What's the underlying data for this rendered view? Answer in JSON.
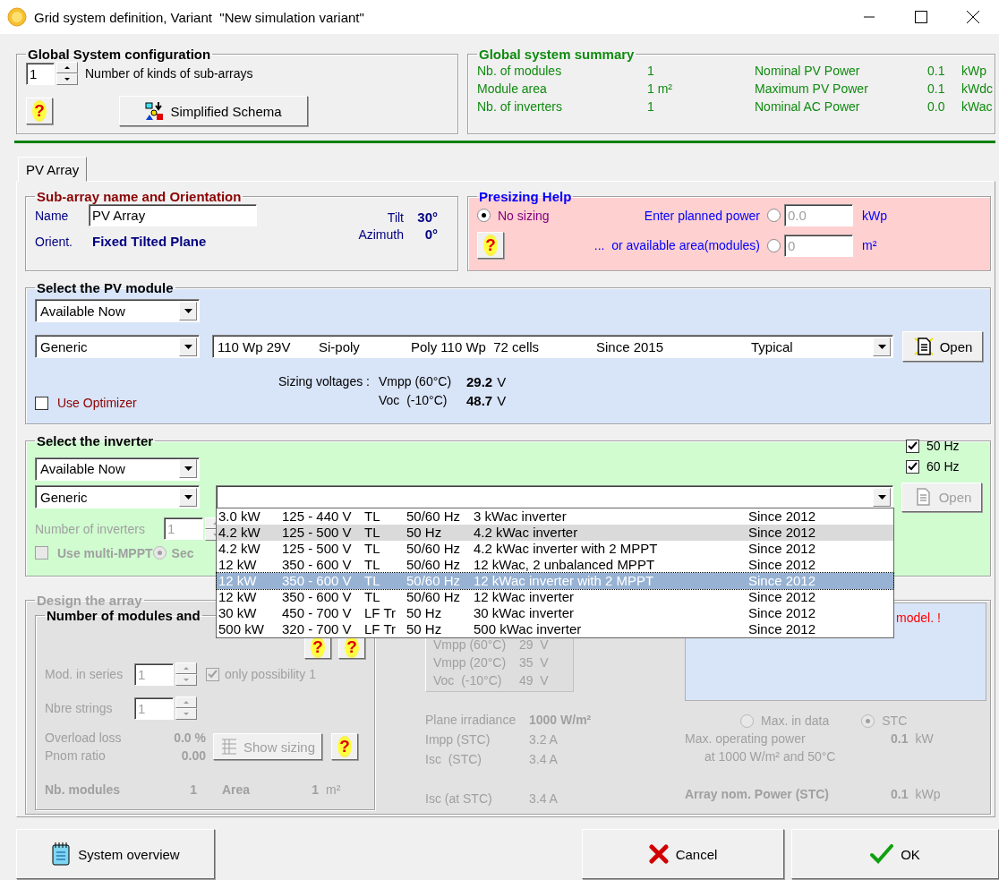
{
  "window": {
    "title": "Grid system definition, Variant  \"New simulation variant\""
  },
  "global_config": {
    "title": "Global System configuration",
    "sub_array_count": "1",
    "sub_array_label": "Number of kinds of sub-arrays",
    "help": "?",
    "schema_button": "Simplified Schema"
  },
  "summary": {
    "title": "Global system summary",
    "left": [
      {
        "label": "Nb. of modules",
        "value": "1"
      },
      {
        "label": "Module area",
        "value": "1 m²"
      },
      {
        "label": "Nb. of inverters",
        "value": "1"
      }
    ],
    "right": [
      {
        "label": "Nominal PV Power",
        "value": "0.1",
        "unit": "kWp"
      },
      {
        "label": "Maximum PV Power",
        "value": "0.1",
        "unit": "kWdc"
      },
      {
        "label": "Nominal AC Power",
        "value": "0.0",
        "unit": "kWac"
      }
    ]
  },
  "tabs": [
    {
      "label": "PV Array",
      "selected": true
    }
  ],
  "orientation": {
    "title": "Sub-array name and Orientation",
    "name_label": "Name",
    "name_value": "PV Array",
    "orient_label": "Orient.",
    "orient_value": "Fixed Tilted Plane",
    "tilt_label": "Tilt",
    "tilt_value": "30°",
    "azimuth_label": "Azimuth",
    "azimuth_value": "0°"
  },
  "presizing": {
    "title": "Presizing Help",
    "help": "?",
    "options": [
      {
        "label": "No sizing",
        "selected": true
      },
      {
        "label": "Enter planned power",
        "selected": false,
        "value": "0.0",
        "unit": "kWp"
      },
      {
        "label": "...  or available area(modules)",
        "selected": false,
        "value": "0",
        "unit": "m²"
      }
    ]
  },
  "pv_module": {
    "title": "Select the PV module",
    "availability": "Available Now",
    "manufacturer": "Generic",
    "module": [
      "110 Wp 29V",
      "Si-poly",
      "Poly 110 Wp  72 cells",
      "Since 2015",
      "Typical"
    ],
    "open_button": "Open",
    "use_optimizer": {
      "label": "Use Optimizer",
      "checked": false
    },
    "sizing_label": "Sizing voltages :",
    "voltages": [
      {
        "label": "Vmpp (60°C)",
        "value": "29.2",
        "unit": "V"
      },
      {
        "label": "Voc  (-10°C)",
        "value": "48.7",
        "unit": "V"
      }
    ]
  },
  "inverter": {
    "title": "Select the inverter",
    "availability": "Available Now",
    "manufacturer": "Generic",
    "frequencies": [
      {
        "label": "50 Hz",
        "checked": true
      },
      {
        "label": "60 Hz",
        "checked": true
      }
    ],
    "open_button": "Open",
    "open_disabled": true,
    "count": {
      "label": "Number of inverters",
      "value": "1",
      "disabled": true
    },
    "multi_mppt": {
      "label": "Use multi-MPPT",
      "checked": false,
      "disabled": true
    },
    "multi_mppt_option": {
      "label": "Sec",
      "selected": true
    },
    "dropdown": [
      {
        "cells": [
          "3.0 kW",
          "125 - 440 V",
          "TL",
          "50/60 Hz",
          "3 kWac inverter",
          "Since 2012"
        ],
        "selected": false,
        "hovered": false
      },
      {
        "cells": [
          "4.2 kW",
          "125 - 500 V",
          "TL",
          "50 Hz",
          "4.2 kWac inverter",
          "Since 2012"
        ],
        "selected": false,
        "hovered": true
      },
      {
        "cells": [
          "4.2 kW",
          "125 - 500 V",
          "TL",
          "50/60 Hz",
          "4.2 kWac inverter with 2 MPPT",
          "Since 2012"
        ],
        "selected": false,
        "hovered": false
      },
      {
        "cells": [
          "12 kW",
          "350 - 600 V",
          "TL",
          "50/60 Hz",
          "12 kWac, 2 unbalanced MPPT",
          "Since 2012"
        ],
        "selected": false,
        "hovered": false
      },
      {
        "cells": [
          "12 kW",
          "350 - 600 V",
          "TL",
          "50/60 Hz",
          "12 kWac inverter with 2 MPPT",
          "Since 2012"
        ],
        "selected": true,
        "hovered": false
      },
      {
        "cells": [
          "12 kW",
          "350 - 600 V",
          "TL",
          "50/60 Hz",
          "12 kWac inverter",
          "Since 2012"
        ],
        "selected": false,
        "hovered": false
      },
      {
        "cells": [
          "30 kW",
          "450 - 700 V",
          "LF Tr",
          "50 Hz",
          "30 kWac inverter",
          "Since 2012"
        ],
        "selected": false,
        "hovered": false
      },
      {
        "cells": [
          "500 kW",
          "320 - 700 V",
          "LF Tr",
          "50 Hz",
          "500 kWac inverter",
          "Since 2012"
        ],
        "selected": false,
        "hovered": false
      }
    ]
  },
  "design": {
    "title": "Design the array",
    "disabled": true,
    "modules_title": "Number of modules and",
    "helps": [
      "?",
      "?",
      "?"
    ],
    "series_label": "Mod. in series",
    "series_value": "1",
    "only_possibility": {
      "label": "only possibility 1",
      "checked": true
    },
    "strings_label": "Nbre strings",
    "strings_value": "1",
    "overload_label": "Overload loss",
    "overload_value": "0.0 %",
    "pnom_label": "Pnom ratio",
    "pnom_value": "0.00",
    "show_sizing": "Show sizing",
    "nb_modules_label": "Nb. modules",
    "nb_modules_value": "1",
    "area_label": "Area",
    "area_value": "1",
    "area_unit": "m²",
    "voltages": [
      {
        "label": "Vmpp (60°C)",
        "value": "29  V"
      },
      {
        "label": "Vmpp (20°C)",
        "value": "35  V"
      },
      {
        "label": "Voc  (-10°C)",
        "value": "49  V"
      }
    ],
    "currents": [
      {
        "label": "Plane irradiance",
        "value": "1000 W/m²",
        "bold": true
      },
      {
        "label": "Impp (STC)",
        "value": "3.2 A",
        "bold": false
      },
      {
        "label": "Isc  (STC)",
        "value": "3.4 A",
        "bold": false
      }
    ],
    "isc_label": "Isc (at STC)",
    "isc_value": "3.4 A",
    "message": "model. !",
    "power_options": [
      {
        "label": "Max. in data",
        "selected": false
      },
      {
        "label": "STC",
        "selected": true
      }
    ],
    "max_power_label": "Max. operating power",
    "max_power_value": "0.1",
    "max_power_unit": "kW",
    "max_power_note": "at 1000 W/m² and 50°C",
    "array_power_label": "Array nom. Power (STC)",
    "array_power_value": "0.1",
    "array_power_unit": "kWp"
  },
  "buttons": [
    {
      "kind": "overview",
      "label": "System overview"
    },
    {
      "kind": "cancel",
      "label": "Cancel"
    },
    {
      "kind": "ok",
      "label": "OK"
    }
  ]
}
